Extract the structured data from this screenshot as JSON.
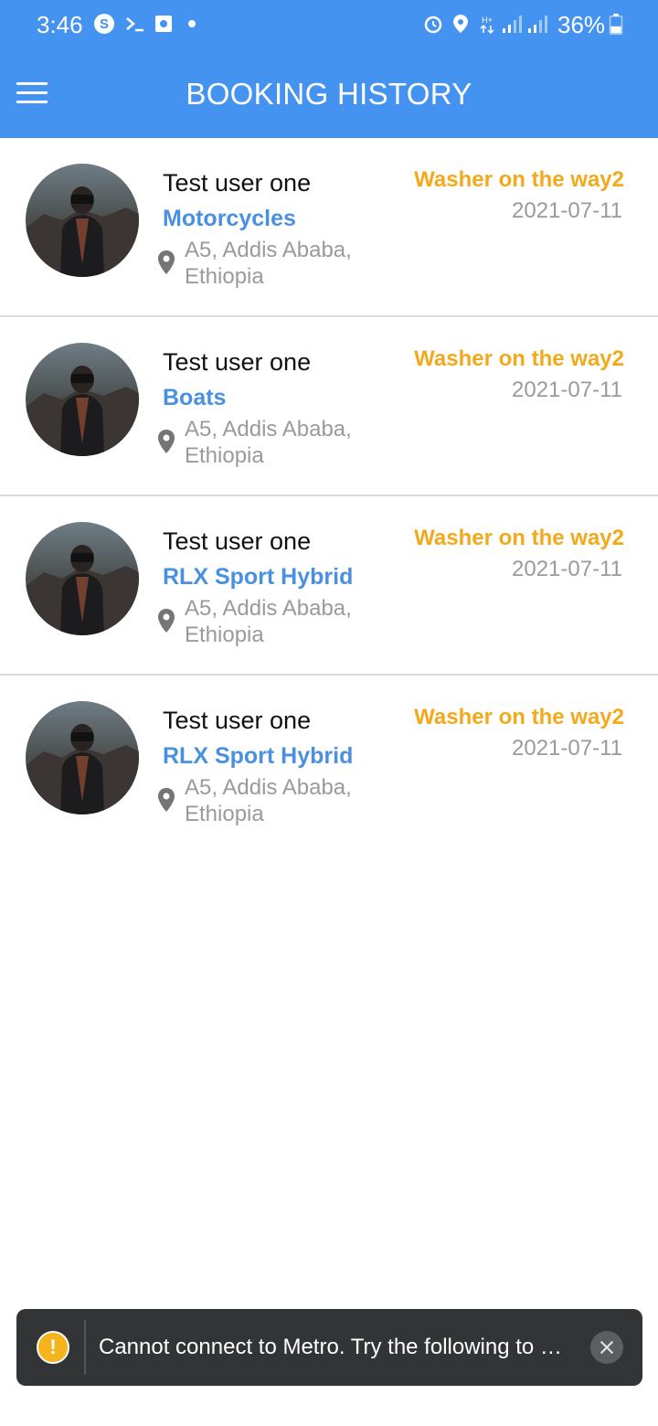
{
  "status_bar": {
    "time": "3:46",
    "battery": "36%",
    "icons": [
      "skype-icon",
      "terminal-icon",
      "screen-record-icon",
      "dot-icon",
      "alarm-icon",
      "location-icon",
      "data-icon",
      "signal-icon",
      "signal-icon",
      "battery-icon"
    ]
  },
  "header": {
    "title": "BOOKING HISTORY"
  },
  "bookings": [
    {
      "name": "Test user one",
      "vehicle": "Motorcycles",
      "address": "A5, Addis Ababa, Ethiopia",
      "status": "Washer on the way2",
      "date": "2021-07-11"
    },
    {
      "name": "Test user one",
      "vehicle": "Boats",
      "address": "A5, Addis Ababa, Ethiopia",
      "status": "Washer on the way2",
      "date": "2021-07-11"
    },
    {
      "name": "Test user one",
      "vehicle": "RLX Sport Hybrid",
      "address": "A5, Addis Ababa, Ethiopia",
      "status": "Washer on the way2",
      "date": "2021-07-11"
    },
    {
      "name": "Test user one",
      "vehicle": "RLX Sport Hybrid",
      "address": "A5, Addis Ababa, Ethiopia",
      "status": "Washer on the way2",
      "date": "2021-07-11"
    }
  ],
  "toast": {
    "message": "Cannot connect to Metro.  Try the following to …",
    "icon": "warning-icon"
  },
  "colors": {
    "primary": "#4593F0",
    "vehicle_text": "#4A90E2",
    "status_text": "#F2A91C",
    "muted_text": "#9a9a9a"
  }
}
